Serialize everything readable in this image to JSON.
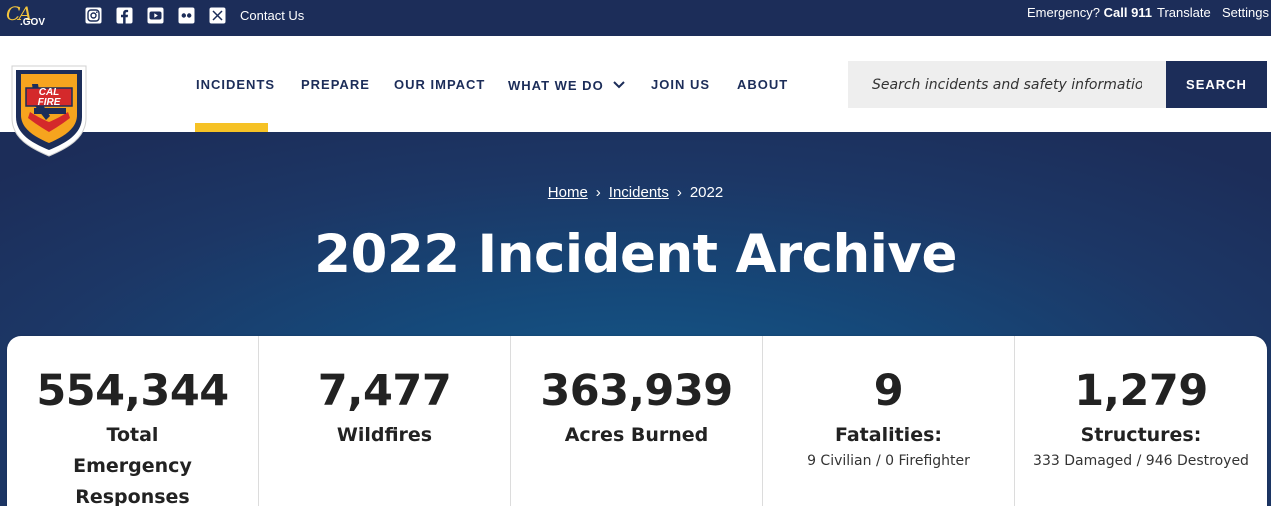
{
  "utility": {
    "ca_logo_text": "CA",
    "ca_gov_text": ".GOV",
    "social_icons": [
      "instagram-icon",
      "facebook-icon",
      "youtube-icon",
      "flickr-icon",
      "x-icon"
    ],
    "contact_label": "Contact Us",
    "emergency_prefix": "Emergency?",
    "emergency_call": "Call 911",
    "translate_label": "Translate",
    "settings_label": "Settings"
  },
  "header": {
    "logo_text": "CAL FIRE",
    "nav": {
      "incidents": "INCIDENTS",
      "prepare": "PREPARE",
      "our_impact": "OUR IMPACT",
      "what_we_do": "WHAT WE DO",
      "join_us": "JOIN US",
      "about": "ABOUT"
    },
    "active_nav": "INCIDENTS",
    "search": {
      "placeholder": "Search incidents and safety information",
      "button_label": "SEARCH"
    }
  },
  "breadcrumb": {
    "home": "Home",
    "incidents": "Incidents",
    "current": "2022",
    "separator": "›"
  },
  "page_title": "2022 Incident Archive",
  "stats": {
    "responses": {
      "value": "554,344",
      "label": "Total Emergency Responses"
    },
    "wildfires": {
      "value": "7,477",
      "label": "Wildfires"
    },
    "acres": {
      "value": "363,939",
      "label": "Acres Burned"
    },
    "fatalities": {
      "value": "9",
      "label": "Fatalities:",
      "detail": "9 Civilian / 0 Firefighter"
    },
    "structures": {
      "value": "1,279",
      "label": "Structures:",
      "detail": "333 Damaged / 946 Destroyed"
    }
  },
  "colors": {
    "navy": "#1c2d59",
    "accent_yellow": "#f6c225",
    "hero_blue": "#165a8a"
  }
}
